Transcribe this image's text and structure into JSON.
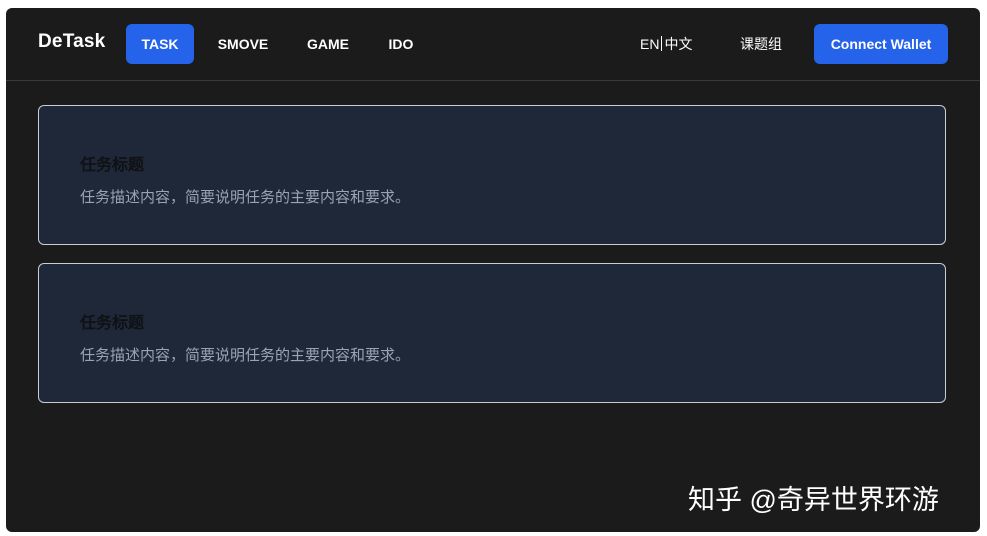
{
  "header": {
    "brand": "DeTask",
    "tabs": [
      {
        "label": "TASK",
        "active": true
      },
      {
        "label": "SMOVE",
        "active": false
      },
      {
        "label": "GAME",
        "active": false
      },
      {
        "label": "IDO",
        "active": false
      }
    ],
    "lang_en": "EN",
    "lang_zh": "中文",
    "group_link": "课题组",
    "connect_wallet": "Connect Wallet"
  },
  "tasks": [
    {
      "title": "任务标题",
      "description": "任务描述内容，简要说明任务的主要内容和要求。"
    },
    {
      "title": "任务标题",
      "description": "任务描述内容，简要说明任务的主要内容和要求。"
    }
  ],
  "watermark": "知乎 @奇异世界环游",
  "colors": {
    "background": "#1b1b1b",
    "accent": "#2563eb",
    "card_background": "#1f2838",
    "card_border": "#c9ced6",
    "muted_text": "#9aa3b2"
  }
}
